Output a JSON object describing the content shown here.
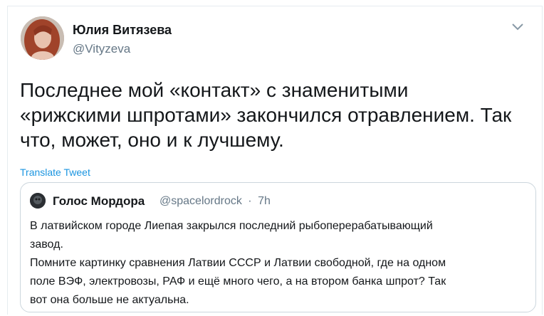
{
  "tweet": {
    "author_name": "Юлия Витязева",
    "author_handle": "@Vityzeva",
    "text_lines": [
      "Последнее мой «контакт» с знаменитыми",
      "«рижскими шпротами» закончился отравлением. Так",
      "что, может, оно и к лучшему."
    ],
    "translate_label": "Translate Tweet",
    "menu_icon": "chevron-down-icon"
  },
  "quoted_tweet": {
    "author_name": "Голос Мордора",
    "author_handle": "@spacelordrock",
    "separator": "·",
    "time": "7h",
    "body_lines": [
      "В латвийском городе Лиепая закрылся последний рыбоперерабатывающий",
      "завод.",
      "Помните картинку сравнения Латвии СССР и Латвии свободной, где на одном",
      "поле ВЭФ, электровозы, РАФ и ещё много чего, а на втором банка шпрот? Так",
      "вот она больше не актуальна."
    ]
  },
  "colors": {
    "text": "#14171a",
    "secondary": "#657786",
    "link": "#1b95e0",
    "border": "#ccd6dd"
  }
}
